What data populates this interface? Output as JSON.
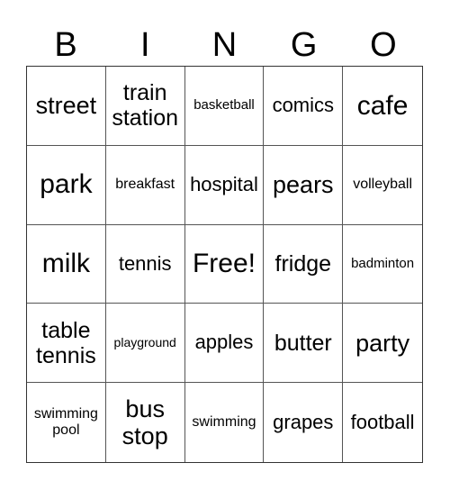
{
  "header": [
    "B",
    "I",
    "N",
    "G",
    "O"
  ],
  "cells": [
    "street",
    "train station",
    "basketball",
    "comics",
    "cafe",
    "park",
    "breakfast",
    "hospital",
    "pears",
    "volleyball",
    "milk",
    "tennis",
    "Free!",
    "fridge",
    "badminton",
    "table tennis",
    "playground",
    "apples",
    "butter",
    "party",
    "swimming pool",
    "bus stop",
    "swimming",
    "grapes",
    "football"
  ]
}
